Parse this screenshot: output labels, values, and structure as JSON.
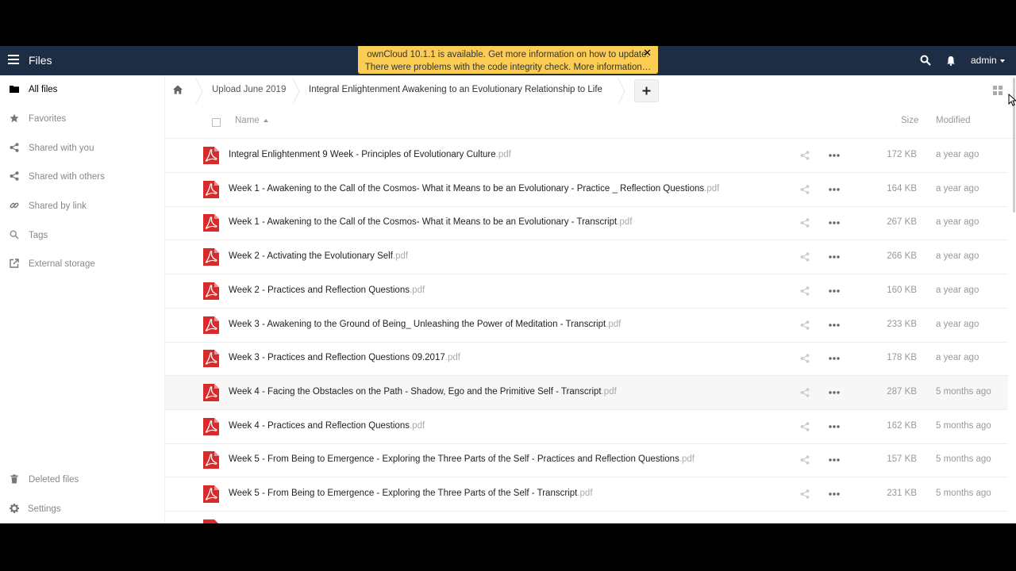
{
  "header": {
    "app_title": "Files",
    "notice_line1": "ownCloud 10.1.1 is available. Get more information on how to update.",
    "notice_line2": "There were problems with the code integrity check. More information…",
    "notice_close": "✕",
    "user": "admin"
  },
  "sidebar": {
    "items": [
      {
        "label": "All files",
        "icon": "folder-icon"
      },
      {
        "label": "Favorites",
        "icon": "star-icon"
      },
      {
        "label": "Shared with you",
        "icon": "share-icon"
      },
      {
        "label": "Shared with others",
        "icon": "share-icon"
      },
      {
        "label": "Shared by link",
        "icon": "link-icon"
      },
      {
        "label": "Tags",
        "icon": "tag-icon"
      },
      {
        "label": "External storage",
        "icon": "external-icon"
      }
    ],
    "deleted": "Deleted files",
    "settings": "Settings"
  },
  "breadcrumb": {
    "items": [
      "Upload June 2019",
      "Integral Enlightenment Awakening to an Evolutionary Relationship to Life"
    ],
    "new_label": "+"
  },
  "columns": {
    "name": "Name",
    "size": "Size",
    "modified": "Modified"
  },
  "files": [
    {
      "name": "Integral Enlightenment 9 Week - Principles of Evolutionary Culture",
      "ext": ".pdf",
      "size": "172 KB",
      "modified": "a year ago"
    },
    {
      "name": "Week 1 - Awakening to the Call of the Cosmos- What it Means to be an Evolutionary - Practice _ Reflection Questions",
      "ext": ".pdf",
      "size": "164 KB",
      "modified": "a year ago"
    },
    {
      "name": "Week 1 - Awakening to the Call of the Cosmos- What it Means to be an Evolutionary - Transcript",
      "ext": ".pdf",
      "size": "267 KB",
      "modified": "a year ago"
    },
    {
      "name": "Week 2 - Activating the Evolutionary Self",
      "ext": ".pdf",
      "size": "266 KB",
      "modified": "a year ago"
    },
    {
      "name": "Week 2 - Practices and Reflection Questions",
      "ext": ".pdf",
      "size": "160 KB",
      "modified": "a year ago"
    },
    {
      "name": "Week 3 - Awakening to the Ground of Being_ Unleashing the Power of Meditation - Transcript",
      "ext": ".pdf",
      "size": "233 KB",
      "modified": "a year ago"
    },
    {
      "name": "Week 3 - Practices and Reflection Questions 09.2017",
      "ext": ".pdf",
      "size": "178 KB",
      "modified": "a year ago"
    },
    {
      "name": "Week 4 - Facing the Obstacles on the Path - Shadow, Ego and the Primitive Self - Transcript",
      "ext": ".pdf",
      "size": "287 KB",
      "modified": "5 months ago"
    },
    {
      "name": "Week 4 - Practices and Reflection Questions",
      "ext": ".pdf",
      "size": "162 KB",
      "modified": "5 months ago"
    },
    {
      "name": "Week 5 - From Being to Emergence - Exploring the Three Parts of the Self - Practices and Reflection Questions",
      "ext": ".pdf",
      "size": "157 KB",
      "modified": "5 months ago"
    },
    {
      "name": "Week 5 - From Being to Emergence - Exploring the Three Parts of the Self - Transcript",
      "ext": ".pdf",
      "size": "231 KB",
      "modified": "5 months ago"
    }
  ],
  "colors": {
    "header_bg": "#1d2d44",
    "notice_bg": "#fccd55",
    "pdf_red": "#d92b2b"
  }
}
